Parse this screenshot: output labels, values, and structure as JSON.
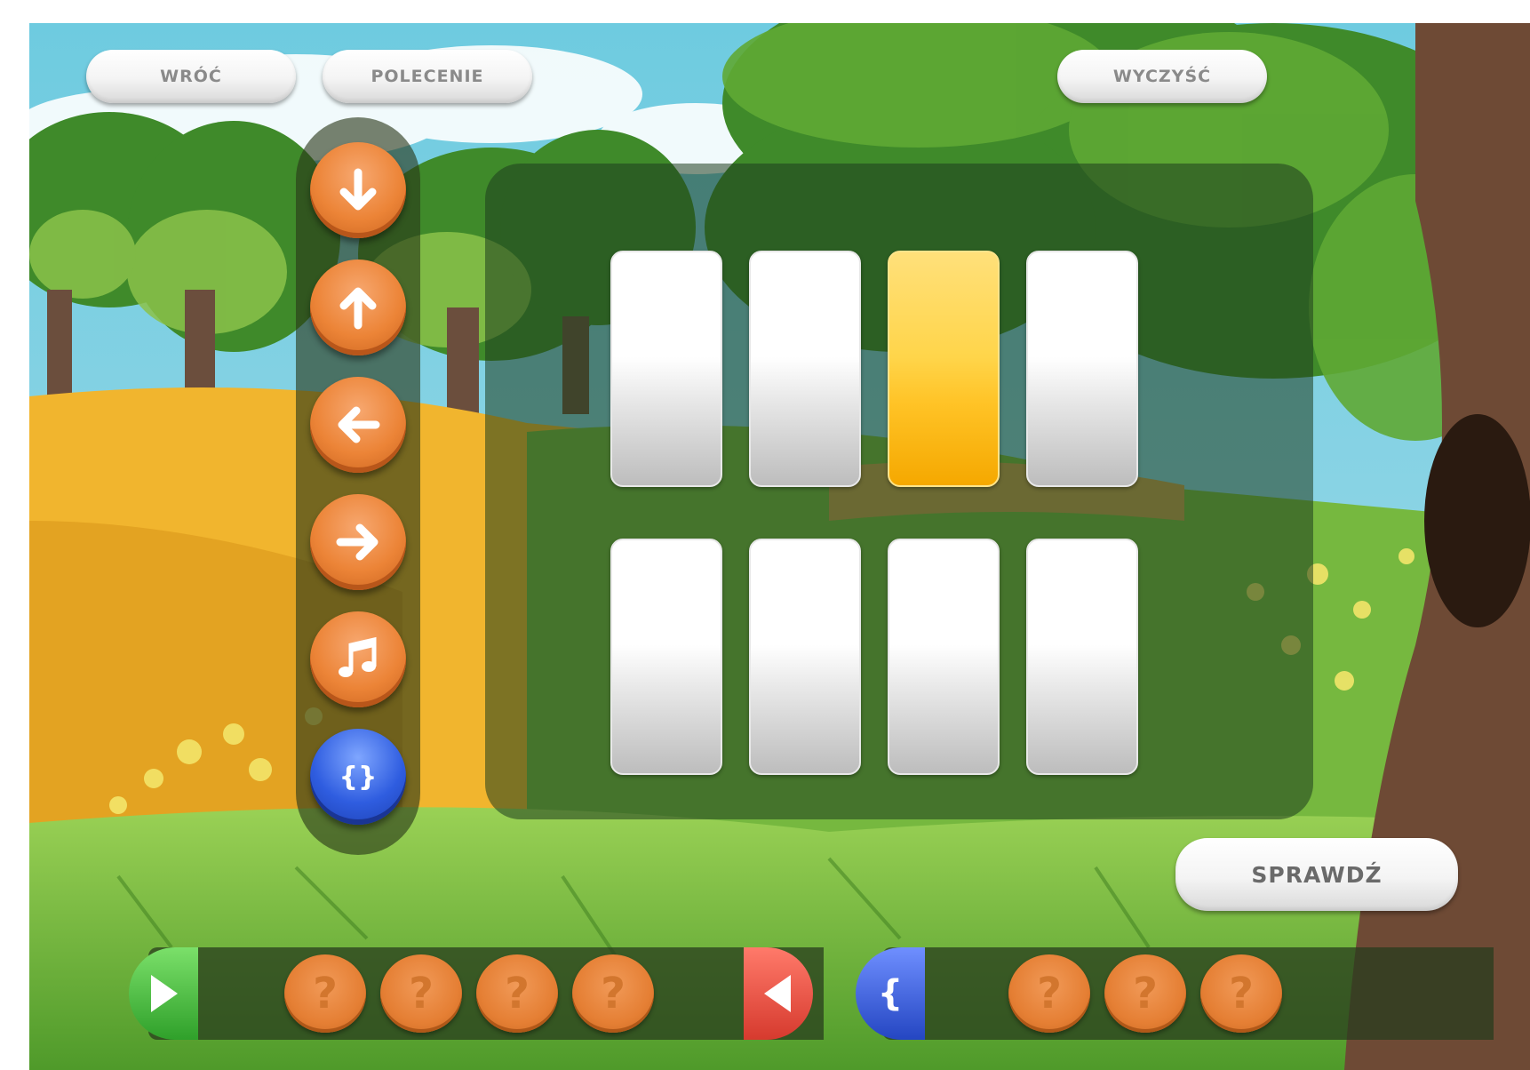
{
  "header": {
    "back_label": "WRÓĆ",
    "task_label": "POLECENIE",
    "clear_label": "WYCZYŚĆ"
  },
  "commands": [
    {
      "name": "arrow-down-icon",
      "color": "#ec8437"
    },
    {
      "name": "arrow-up-icon",
      "color": "#ec8437"
    },
    {
      "name": "arrow-left-icon",
      "color": "#ec8437"
    },
    {
      "name": "arrow-right-icon",
      "color": "#ec8437"
    },
    {
      "name": "music-note-icon",
      "color": "#ec8437"
    },
    {
      "name": "braces-icon",
      "color": "#2f5de0",
      "label": "{}"
    }
  ],
  "board": {
    "rows": 2,
    "columns": 4,
    "active_tile": {
      "row": 1,
      "column": 3,
      "color": "#ffc326"
    }
  },
  "program": {
    "main_slots": [
      "?",
      "?",
      "?",
      "?"
    ],
    "function_label": "{",
    "function_slots": [
      "?",
      "?",
      "?"
    ]
  },
  "check_label": "SPRAWDŹ"
}
